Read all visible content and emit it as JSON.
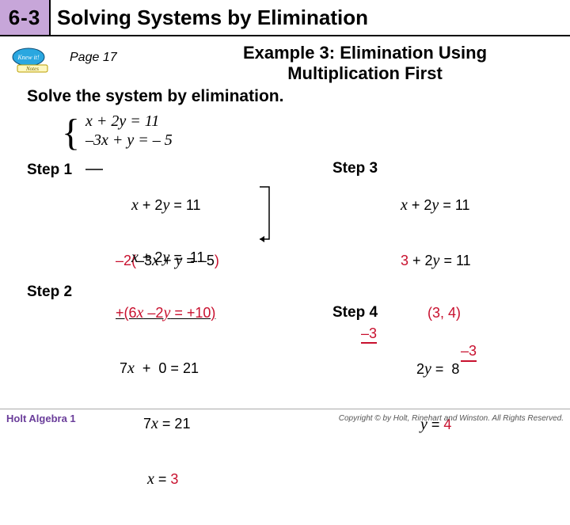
{
  "header": {
    "lesson_number": "6-3",
    "title": "Solving Systems by Elimination"
  },
  "knew_it": {
    "top": "Knew it!",
    "bottom": "Notes"
  },
  "page_label": "Page 17",
  "example_title_line1": "Example 3: Elimination Using",
  "example_title_line2": "Multiplication First",
  "instruction": "Solve the system by elimination.",
  "system_line1": "x + 2y = 11",
  "system_line2": "–3x + y = – 5",
  "steps": {
    "s1": "Step 1",
    "s2": "Step 2",
    "s3": "Step 3",
    "s4": "Step 4"
  },
  "block1": {
    "l1": "    x + 2y = 11",
    "l2": "–2(–3x + y = –5)"
  },
  "block2": {
    "l1": "    x + 2y =  11",
    "l2": "+(6x –2y = +10)",
    "l3": " 7x  +  0 = 21",
    "l4": "       7x = 21",
    "l5": "        x = 3"
  },
  "block3": {
    "l1": "x + 2y = 11",
    "l2": "3 + 2y = 11",
    "l3a": "–3",
    "l3b": "–3",
    "l4": "    2y =  8",
    "l5": "     y = 4"
  },
  "solution": "(3, 4)",
  "footer": {
    "left": "Holt Algebra 1",
    "right": "Copyright © by Holt, Rinehart and Winston. All Rights Reserved."
  }
}
